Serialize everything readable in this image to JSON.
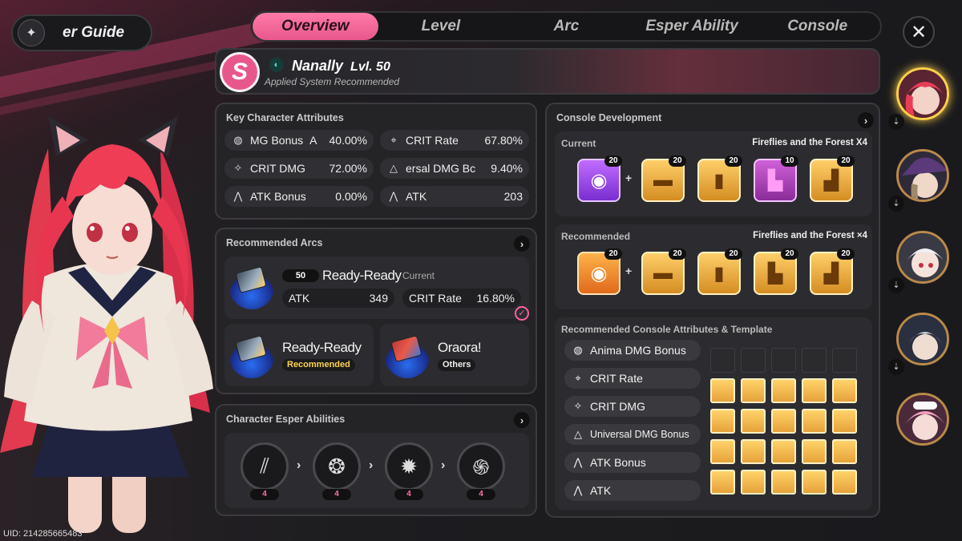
{
  "guide": {
    "label": "er Guide",
    "icon": "book-icon"
  },
  "tabs": [
    {
      "label": "Overview",
      "active": true
    },
    {
      "label": "Level",
      "active": false
    },
    {
      "label": "Arc",
      "active": false
    },
    {
      "label": "Esper Ability",
      "active": false
    },
    {
      "label": "Console",
      "active": false
    }
  ],
  "header": {
    "rank": "S",
    "name": "Nanally",
    "level": "Lvl. 50",
    "subtitle": "Applied System Recommended"
  },
  "key_attributes": {
    "title": "Key Character Attributes",
    "items": [
      {
        "name": "MG Bonus",
        "name_suffix": "A",
        "value": "40.00%",
        "icon": "anima-icon"
      },
      {
        "name": "CRIT Rate",
        "value": "67.80%",
        "icon": "crosshair-icon"
      },
      {
        "name": "CRIT DMG",
        "value": "72.00%",
        "icon": "crit-dmg-icon"
      },
      {
        "name": "ersal DMG Bc",
        "value": "9.40%",
        "icon": "triangle-icon"
      },
      {
        "name": "ATK Bonus",
        "value": "0.00%",
        "icon": "atk-icon"
      },
      {
        "name": "ATK",
        "value": "203",
        "icon": "atk-icon"
      }
    ]
  },
  "recommended_arcs": {
    "title": "Recommended Arcs",
    "current": {
      "level": "50",
      "name": "Ready-Ready",
      "tag": "Current",
      "stats": [
        {
          "name": "ATK",
          "value": "349"
        },
        {
          "name": "CRIT Rate",
          "value": "16.80%"
        }
      ]
    },
    "options": [
      {
        "name": "Ready-Ready",
        "tag": "Recommended"
      },
      {
        "name": "Oraora!",
        "tag": "Others"
      }
    ]
  },
  "esper_abilities": {
    "title": "Character Esper Abilities",
    "slots": [
      {
        "level": "4",
        "icon": "claw-icon"
      },
      {
        "level": "4",
        "icon": "creature-icon"
      },
      {
        "level": "4",
        "icon": "burst-icon"
      },
      {
        "level": "4",
        "icon": "swirl-icon"
      }
    ]
  },
  "console_development": {
    "title": "Console Development",
    "current": {
      "label": "Current",
      "set_name": "Fireflies and the Forest X4",
      "items": [
        {
          "level": "20",
          "color": "purple",
          "icon": "anima-icon"
        },
        {
          "level": "20",
          "color": "gold",
          "icon": "block-2h-icon"
        },
        {
          "level": "20",
          "color": "gold",
          "icon": "block-2v-icon"
        },
        {
          "level": "10",
          "color": "pink",
          "icon": "block-l-icon"
        },
        {
          "level": "20",
          "color": "gold",
          "icon": "block-s-icon"
        }
      ]
    },
    "recommended": {
      "label": "Recommended",
      "set_name": "Fireflies and the Forest ×4",
      "items": [
        {
          "level": "20",
          "color": "orange",
          "icon": "anima-icon"
        },
        {
          "level": "20",
          "color": "gold",
          "icon": "block-2h-icon"
        },
        {
          "level": "20",
          "color": "gold",
          "icon": "block-2v-icon"
        },
        {
          "level": "20",
          "color": "gold",
          "icon": "block-l-icon"
        },
        {
          "level": "20",
          "color": "gold",
          "icon": "block-s-icon"
        }
      ]
    }
  },
  "console_template": {
    "title": "Recommended Console Attributes & Template",
    "attributes": [
      {
        "name": "Anima DMG Bonus",
        "icon": "anima-icon"
      },
      {
        "name": "CRIT Rate",
        "icon": "crosshair-icon"
      },
      {
        "name": "CRIT DMG",
        "icon": "crit-dmg-icon"
      },
      {
        "name": "Universal DMG Bonus",
        "icon": "triangle-icon"
      },
      {
        "name": "ATK Bonus",
        "icon": "atk-icon"
      },
      {
        "name": "ATK",
        "icon": "atk-icon"
      }
    ]
  },
  "roster": [
    {
      "name": "roster-nanally",
      "active": true
    },
    {
      "name": "roster-witch-hat",
      "active": false
    },
    {
      "name": "roster-white-hair",
      "active": false
    },
    {
      "name": "roster-silver-hair",
      "active": false
    },
    {
      "name": "roster-pink-hair",
      "active": false
    }
  ],
  "uid": "UID: 214285665483",
  "colors": {
    "accent": "#e8578c",
    "gold": "#ffd36a",
    "panel": "#242427"
  }
}
